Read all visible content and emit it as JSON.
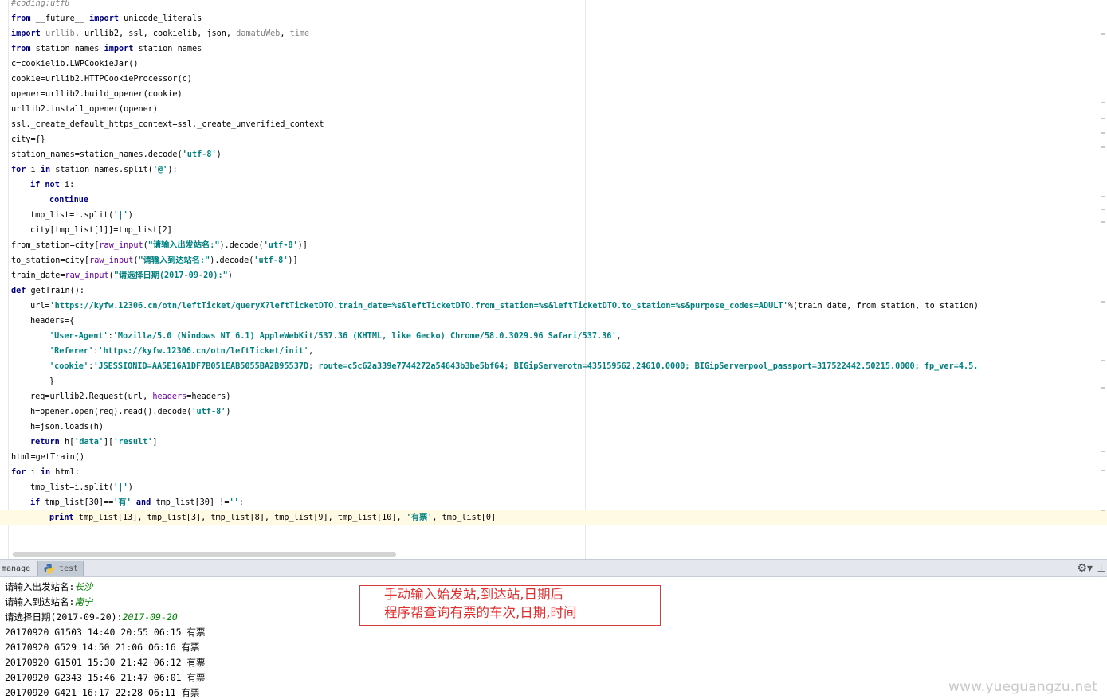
{
  "editor": {
    "lines": [
      {
        "indent": 0,
        "segments": [
          {
            "t": "#coding:utf8",
            "c": "cmt"
          }
        ]
      },
      {
        "indent": 0,
        "segments": [
          {
            "t": "from",
            "c": "kw"
          },
          {
            "t": " __future__ "
          },
          {
            "t": "import",
            "c": "kw"
          },
          {
            "t": " unicode_literals"
          }
        ]
      },
      {
        "indent": 0,
        "segments": [
          {
            "t": "import",
            "c": "kw"
          },
          {
            "t": " "
          },
          {
            "t": "urllib",
            "c": "dim"
          },
          {
            "t": ", urllib2, ssl, cookielib, json, "
          },
          {
            "t": "damatuWeb",
            "c": "dim"
          },
          {
            "t": ", "
          },
          {
            "t": "time",
            "c": "dim"
          }
        ]
      },
      {
        "indent": 0,
        "segments": [
          {
            "t": "from",
            "c": "kw"
          },
          {
            "t": " station_names "
          },
          {
            "t": "import",
            "c": "kw"
          },
          {
            "t": " station_names"
          }
        ]
      },
      {
        "indent": 0,
        "segments": [
          {
            "t": "c=cookielib.LWPCookieJar()"
          }
        ]
      },
      {
        "indent": 0,
        "segments": [
          {
            "t": "cookie=urllib2.HTTPCookieProcessor(c)"
          }
        ]
      },
      {
        "indent": 0,
        "segments": [
          {
            "t": "opener=urllib2.build_opener(cookie)"
          }
        ]
      },
      {
        "indent": 0,
        "segments": [
          {
            "t": "urllib2.install_opener(opener)"
          }
        ]
      },
      {
        "indent": 0,
        "segments": [
          {
            "t": "ssl._create_default_https_context=ssl._create_unverified_context"
          }
        ]
      },
      {
        "indent": 0,
        "segments": [
          {
            "t": "city={}"
          }
        ]
      },
      {
        "indent": 0,
        "segments": [
          {
            "t": "station_names=station_names.decode("
          },
          {
            "t": "'utf-8'",
            "c": "str"
          },
          {
            "t": ")"
          }
        ]
      },
      {
        "indent": 0,
        "segments": [
          {
            "t": "for",
            "c": "kw"
          },
          {
            "t": " i "
          },
          {
            "t": "in",
            "c": "kw"
          },
          {
            "t": " station_names.split("
          },
          {
            "t": "'@'",
            "c": "str"
          },
          {
            "t": "):"
          }
        ]
      },
      {
        "indent": 1,
        "segments": [
          {
            "t": "if",
            "c": "kw"
          },
          {
            "t": " "
          },
          {
            "t": "not",
            "c": "kw"
          },
          {
            "t": " i:"
          }
        ]
      },
      {
        "indent": 2,
        "segments": [
          {
            "t": "continue",
            "c": "kw"
          }
        ]
      },
      {
        "indent": 1,
        "segments": [
          {
            "t": "tmp_list=i.split("
          },
          {
            "t": "'|'",
            "c": "str"
          },
          {
            "t": ")"
          }
        ]
      },
      {
        "indent": 1,
        "segments": [
          {
            "t": "city[tmp_list[1]]=tmp_list[2]"
          }
        ]
      },
      {
        "indent": 0,
        "segments": [
          {
            "t": "from_station=city["
          },
          {
            "t": "raw_input",
            "c": "kwarg"
          },
          {
            "t": "("
          },
          {
            "t": "\"请输入出发站名:\"",
            "c": "str"
          },
          {
            "t": ").decode("
          },
          {
            "t": "'utf-8'",
            "c": "str"
          },
          {
            "t": ")]"
          }
        ]
      },
      {
        "indent": 0,
        "segments": [
          {
            "t": "to_station=city["
          },
          {
            "t": "raw_input",
            "c": "kwarg"
          },
          {
            "t": "("
          },
          {
            "t": "\"请输入到达站名:\"",
            "c": "str"
          },
          {
            "t": ").decode("
          },
          {
            "t": "'utf-8'",
            "c": "str"
          },
          {
            "t": ")]"
          }
        ]
      },
      {
        "indent": 0,
        "segments": [
          {
            "t": "train_date="
          },
          {
            "t": "raw_input",
            "c": "kwarg"
          },
          {
            "t": "("
          },
          {
            "t": "\"请选择日期(2017-09-20):\"",
            "c": "str"
          },
          {
            "t": ")"
          }
        ]
      },
      {
        "indent": 0,
        "segments": [
          {
            "t": "def",
            "c": "kw"
          },
          {
            "t": " getTrain():"
          }
        ]
      },
      {
        "indent": 1,
        "segments": [
          {
            "t": "url="
          },
          {
            "t": "'https://kyfw.12306.cn/otn/leftTicket/queryX?leftTicketDTO.train_date=%s&leftTicketDTO.from_station=%s&leftTicketDTO.to_station=%s&purpose_codes=ADULT'",
            "c": "url-str"
          },
          {
            "t": "%(train_date, from_station, to_station)"
          }
        ]
      },
      {
        "indent": 1,
        "segments": [
          {
            "t": "headers={"
          }
        ]
      },
      {
        "indent": 2,
        "segments": [
          {
            "t": "'User-Agent'",
            "c": "str"
          },
          {
            "t": ":"
          },
          {
            "t": "'Mozilla/5.0 (Windows NT 6.1) AppleWebKit/537.36 (KHTML, like Gecko) Chrome/58.0.3029.96 Safari/537.36'",
            "c": "str"
          },
          {
            "t": ","
          }
        ]
      },
      {
        "indent": 2,
        "segments": [
          {
            "t": "'Referer'",
            "c": "str"
          },
          {
            "t": ":"
          },
          {
            "t": "'https://kyfw.12306.cn/otn/leftTicket/init'",
            "c": "str"
          },
          {
            "t": ","
          }
        ]
      },
      {
        "indent": 2,
        "segments": [
          {
            "t": "'cookie'",
            "c": "str"
          },
          {
            "t": ":"
          },
          {
            "t": "'JSESSIONID=AA5E16A1DF7B051EAB5055BA2B95537D; route=c5c62a339e7744272a54643b3be5bf64; BIGipServerotn=435159562.24610.0000; BIGipServerpool_passport=317522442.50215.0000; fp_ver=4.5.",
            "c": "str"
          }
        ]
      },
      {
        "indent": 2,
        "segments": [
          {
            "t": "}"
          }
        ]
      },
      {
        "indent": 1,
        "segments": [
          {
            "t": "req=urllib2.Request(url, "
          },
          {
            "t": "headers",
            "c": "kwarg"
          },
          {
            "t": "=headers)"
          }
        ]
      },
      {
        "indent": 1,
        "segments": [
          {
            "t": "h=opener.open(req).read().decode("
          },
          {
            "t": "'utf-8'",
            "c": "str"
          },
          {
            "t": ")"
          }
        ]
      },
      {
        "indent": 1,
        "segments": [
          {
            "t": "h=json.loads(h)"
          }
        ]
      },
      {
        "indent": 1,
        "segments": [
          {
            "t": "return",
            "c": "kw"
          },
          {
            "t": " h["
          },
          {
            "t": "'data'",
            "c": "str"
          },
          {
            "t": "]["
          },
          {
            "t": "'result'",
            "c": "str"
          },
          {
            "t": "]"
          }
        ]
      },
      {
        "indent": 0,
        "segments": [
          {
            "t": "html=getTrain()"
          }
        ]
      },
      {
        "indent": 0,
        "segments": [
          {
            "t": "for",
            "c": "kw"
          },
          {
            "t": " i "
          },
          {
            "t": "in",
            "c": "kw"
          },
          {
            "t": " html:"
          }
        ]
      },
      {
        "indent": 1,
        "segments": [
          {
            "t": "tmp_list=i.split("
          },
          {
            "t": "'|'",
            "c": "str"
          },
          {
            "t": ")"
          }
        ]
      },
      {
        "indent": 1,
        "segments": [
          {
            "t": "if",
            "c": "kw"
          },
          {
            "t": " tmp_list[30]=="
          },
          {
            "t": "'有'",
            "c": "str"
          },
          {
            "t": " "
          },
          {
            "t": "and",
            "c": "kw"
          },
          {
            "t": " tmp_list[30] !="
          },
          {
            "t": "''",
            "c": "str"
          },
          {
            "t": ":"
          }
        ]
      },
      {
        "indent": 2,
        "current": true,
        "segments": [
          {
            "t": "print",
            "c": "kw"
          },
          {
            "t": " tmp_list[13], tmp_list[3], tmp_list[8], tmp_list[9], tmp_list[10], "
          },
          {
            "t": "'有票'",
            "c": "str"
          },
          {
            "t": ", tmp_list[0]"
          }
        ]
      }
    ]
  },
  "run_panel": {
    "tab_manage_label": "manage",
    "tab_test_label": "test",
    "settings_icon": "gear-icon",
    "pin_icon": "pin-icon"
  },
  "console": {
    "lines": [
      {
        "prompt": "请输入出发站名:",
        "input": "长沙"
      },
      {
        "prompt": "请输入到达站名:",
        "input": "南宁"
      },
      {
        "prompt": "请选择日期(2017-09-20):",
        "input": "2017-09-20"
      },
      {
        "prompt": "20170920 G1503 14:40 20:55 06:15 有票",
        "input": ""
      },
      {
        "prompt": "20170920 G529 14:50 21:06 06:16 有票",
        "input": ""
      },
      {
        "prompt": "20170920 G1501 15:30 21:42 06:12 有票",
        "input": ""
      },
      {
        "prompt": "20170920 G2343 15:46 21:47 06:01 有票",
        "input": ""
      },
      {
        "prompt": "20170920 G421 16:17 22:28 06:11 有票",
        "input": ""
      }
    ]
  },
  "annotation": {
    "line1": "手动输入始发站,到达站,日期后",
    "line2": "程序帮查询有票的车次,日期,时间",
    "color": "#e03030"
  },
  "watermark": "www.yueguangzu.net"
}
